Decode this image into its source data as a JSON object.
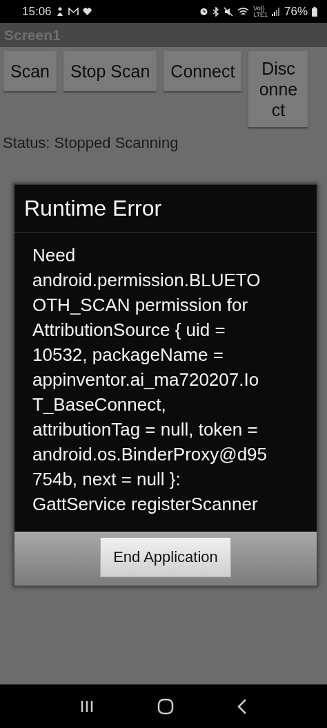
{
  "status_bar": {
    "time": "15:06",
    "volte": [
      "Vo))",
      "LTE1"
    ],
    "battery": "76%"
  },
  "app_bar": {
    "title": "Screen1"
  },
  "buttons": [
    {
      "label": "Scan"
    },
    {
      "label": "Stop Scan"
    },
    {
      "label": "Connect"
    },
    {
      "label": "Disc onne ct"
    }
  ],
  "status_label": "Status: Stopped Scanning",
  "dialog": {
    "title": "Runtime Error",
    "message": "Need android.permission.BLUETOOTH_SCAN permission for AttributionSource { uid = 10532, packageName = appinventor.ai_ma720207.IoT_BaseConnect, attributionTag = null, token = android.os.BinderProxy@d95754b, next = null }: GattService registerScanner",
    "button": "End Application"
  }
}
